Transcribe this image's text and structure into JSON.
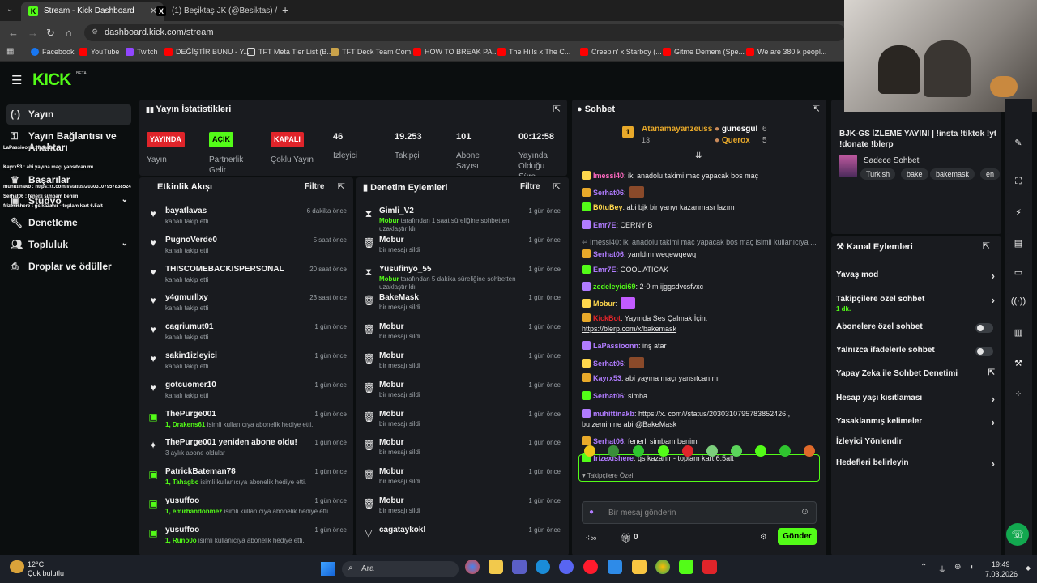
{
  "browser": {
    "tabs": [
      {
        "title": "Stream - Kick Dashboard",
        "fav": "K"
      },
      {
        "title": "(1) Beşiktaş JK (@Besiktas) / X",
        "fav": "X"
      }
    ],
    "url": "dashboard.kick.com/stream",
    "bookmarks": [
      "Facebook",
      "YouTube",
      "Twitch",
      "DEĞİŞTİR BUNU - Y...",
      "TFT Meta Tier List (B...",
      "TFT Deck Team Com...",
      "HOW TO BREAK PA...",
      "The Hills x The C...",
      "Creepin' x Starboy (...",
      "Gitme Demem (Spe...",
      "We are 380 k peopl..."
    ],
    "colors": {
      "kick": "#53fc18",
      "red": "#e0242a",
      "panel": "#191b1f"
    }
  },
  "kick": {
    "logo": "KICK",
    "logo_sup": "BETA"
  },
  "sidebar": {
    "items": [
      {
        "label": "Yayın",
        "icon": "stream-icon"
      },
      {
        "label": "Yayın Bağlantısı ve Anahtarı",
        "icon": "key-icon"
      },
      {
        "label": "Başarılar",
        "icon": "trophy-icon"
      },
      {
        "label": "Stüdyo",
        "icon": "studio-icon"
      },
      {
        "label": "Denetleme",
        "icon": "wrench-icon"
      },
      {
        "label": "Topluluk",
        "icon": "people-icon"
      },
      {
        "label": "Droplar ve ödüller",
        "icon": "gift-icon"
      }
    ]
  },
  "stats": {
    "title": "Yayın İstatistikleri",
    "items": [
      {
        "value": "YAYINDA",
        "label": "Yayın",
        "kind": "badge-red"
      },
      {
        "value": "AÇIK",
        "label": "Partnerlik Gelir",
        "kind": "badge-green"
      },
      {
        "value": "KAPALI",
        "label": "Çoklu Yayın",
        "kind": "badge-red"
      },
      {
        "value": "46",
        "label": "İzleyici"
      },
      {
        "value": "19.253",
        "label": "Takipçi"
      },
      {
        "value": "101",
        "label": "Abone Sayısı"
      },
      {
        "value": "00:12:58",
        "label": "Yayında Olduğu Süre"
      }
    ]
  },
  "activity": {
    "title": "Etkinlik Akışı",
    "filter": "Filtre",
    "rows": [
      {
        "name": "bayatlavas",
        "desc": "kanalı takip etti",
        "time": "6 dakika önce",
        "icon": "heart-icon"
      },
      {
        "name": "PugnoVerde0",
        "desc": "kanalı takip etti",
        "time": "5 saat önce",
        "icon": "heart-icon"
      },
      {
        "name": "THISCOMEBACKISPERSONAL",
        "desc": "kanalı takip etti",
        "time": "20 saat önce",
        "icon": "heart-icon"
      },
      {
        "name": "y4gmurllxy",
        "desc": "kanalı takip etti",
        "time": "23 saat önce",
        "icon": "heart-icon"
      },
      {
        "name": "cagriumut01",
        "desc": "kanalı takip etti",
        "time": "1 gün önce",
        "icon": "heart-icon"
      },
      {
        "name": "sakin1izleyici",
        "desc": "kanalı takip etti",
        "time": "1 gün önce",
        "icon": "heart-icon"
      },
      {
        "name": "gotcuomer10",
        "desc": "kanalı takip etti",
        "time": "1 gün önce",
        "icon": "heart-icon"
      },
      {
        "name": "ThePurge001",
        "hl": "1, Drakens61",
        "desc": " isimli kullanıcıya abonelik hediye etti.",
        "time": "1 gün önce",
        "icon": "gift-icon"
      },
      {
        "name": "ThePurge001 yeniden abone oldu!",
        "desc": "3 aylık abone oldular",
        "time": "1 gün önce",
        "icon": "sparkle-icon"
      },
      {
        "name": "PatrickBateman78",
        "hl": "1, Tahagbc",
        "desc": " isimli kullanıcıya abonelik hediye etti.",
        "time": "1 gün önce",
        "icon": "gift-icon"
      },
      {
        "name": "yusuffoo",
        "hl": "1, emirhandonmez",
        "desc": " isimli kullanıcıya abonelik hediye etti.",
        "time": "1 gün önce",
        "icon": "gift-icon"
      },
      {
        "name": "yusuffoo",
        "hl": "1, Runo0o",
        "desc": " isimli kullanıcıya abonelik hediye etti.",
        "time": "1 gün önce",
        "icon": "gift-icon"
      }
    ]
  },
  "moderation": {
    "title": "Denetim Eylemleri",
    "filter": "Filtre",
    "rows": [
      {
        "name": "Gimli_V2",
        "hl": "Mobur",
        "desc": " tarafından 1 saat süreliğine sohbetten uzaklaştırıldı",
        "time": "1 gün önce",
        "icon": "hourglass-icon"
      },
      {
        "name": "Mobur",
        "desc": "bir mesajı sildi",
        "time": "1 gün önce",
        "icon": "trash-icon"
      },
      {
        "name": "Yusufinyo_55",
        "hl": "Mobur",
        "desc": " tarafından 5 dakika süreliğine sohbetten uzaklaştırıldı",
        "time": "1 gün önce",
        "icon": "hourglass-icon"
      },
      {
        "name": "BakeMask",
        "desc": "bir mesajı sildi",
        "time": "1 gün önce",
        "icon": "trash-icon"
      },
      {
        "name": "Mobur",
        "desc": "bir mesajı sildi",
        "time": "1 gün önce",
        "icon": "trash-icon"
      },
      {
        "name": "Mobur",
        "desc": "bir mesajı sildi",
        "time": "1 gün önce",
        "icon": "trash-icon"
      },
      {
        "name": "Mobur",
        "desc": "bir mesajı sildi",
        "time": "1 gün önce",
        "icon": "trash-icon"
      },
      {
        "name": "Mobur",
        "desc": "bir mesajı sildi",
        "time": "1 gün önce",
        "icon": "trash-icon"
      },
      {
        "name": "Mobur",
        "desc": "bir mesajı sildi",
        "time": "1 gün önce",
        "icon": "trash-icon"
      },
      {
        "name": "Mobur",
        "desc": "bir mesajı sildi",
        "time": "1 gün önce",
        "icon": "trash-icon"
      },
      {
        "name": "Mobur",
        "desc": "bir mesajı sildi",
        "time": "1 gün önce",
        "icon": "trash-icon"
      },
      {
        "name": "cagataykokl",
        "desc": "",
        "time": "1 gün önce",
        "icon": "filter-icon"
      }
    ]
  },
  "chat": {
    "title": "Sohbet",
    "top_user": "Atanamayanzeuss",
    "top_count": "13",
    "pill1_user": "gunesgul",
    "pill1_count": "6",
    "pill2_user": "Querox",
    "pill2_count": "5",
    "messages": [
      {
        "user": "Imessi40",
        "color": "#ff6ac1",
        "text": ": iki anadolu takimi mac yapacak bos maç"
      },
      {
        "user": "Serhat06",
        "color": "#b17cff",
        "text": ":"
      },
      {
        "user": "B0tuBey",
        "color": "#ffd84d",
        "text": ": abi bjk bir yarıyı kazanması lazım"
      },
      {
        "user": "Emr7E",
        "color": "#b17cff",
        "text": ": CERNY B"
      },
      {
        "user": "",
        "color": "#9aa0a5",
        "text": "↩ Imessi40: iki anadolu takimi mac yapacak bos maç isimli kullanıcıya ..."
      },
      {
        "user": "Serhat06",
        "color": "#b17cff",
        "text": ": yarıldım weqewqewq"
      },
      {
        "user": "Emr7E",
        "color": "#b17cff",
        "text": ": GOOL ATICAK"
      },
      {
        "user": "zedeleyici69",
        "color": "#53fc18",
        "text": ": 2-0 m ijggsdvcsfvxc"
      },
      {
        "user": "Mobur",
        "color": "#ffd84d",
        "text": ":"
      },
      {
        "user": "KickBot",
        "color": "#e0242a",
        "text": ": Yayında Ses Çalmak İçin:"
      },
      {
        "user": "",
        "color": "#e8e8e8",
        "text": "https://blerp.com/x/bakemask"
      },
      {
        "user": "LaPassioonn",
        "color": "#b17cff",
        "text": ": inş atar"
      },
      {
        "user": "Serhat06",
        "color": "#b17cff",
        "text": ":"
      },
      {
        "user": "Kayrx53",
        "color": "#b17cff",
        "text": ": abi yayına maçı yansıtcan mı"
      },
      {
        "user": "Serhat06",
        "color": "#b17cff",
        "text": ": simba"
      },
      {
        "user": "muhittinakb",
        "color": "#b17cff",
        "text": ": https://x. com/i/status/2030310795783852426 ,"
      },
      {
        "user": "",
        "color": "#e8e8e8",
        "text": "bu zemin ne abi @BakeMask"
      },
      {
        "user": "Serhat06",
        "color": "#b17cff",
        "text": ": fenerli simbam benim"
      },
      {
        "user": "frizexishere",
        "color": "#b17cff",
        "text": ": gs kazanır - toplam kart 6.5alt"
      }
    ],
    "followers_only": "Takipçilere Özel",
    "input_placeholder": "Bir mesaj gönderin",
    "points": "0",
    "send": "Gönder"
  },
  "stream_info": {
    "title": "BJK-GS İZLEME YAYINI | !insta !tiktok !yt !donate !blerp",
    "category": "Sadece Sohbet",
    "tags": [
      "Turkish",
      "bake",
      "bakemask",
      "en"
    ]
  },
  "channel_actions": {
    "title": "Kanal Eylemleri",
    "items": [
      {
        "label": "Yavaş mod",
        "control": "arrow"
      },
      {
        "label": "Takipçilere özel sohbet",
        "sub": "1 dk.",
        "control": "arrow"
      },
      {
        "label": "Abonelere özel sohbet",
        "control": "toggle"
      },
      {
        "label": "Yalnızca ifadelerle sohbet",
        "control": "toggle"
      },
      {
        "label": "Yapay Zeka ile Sohbet Denetimi",
        "control": "ext"
      },
      {
        "label": "Hesap yaşı kısıtlaması",
        "control": "arrow"
      },
      {
        "label": "Yasaklanmış kelimeler",
        "control": "arrow"
      },
      {
        "label": "İzleyici Yönlendir",
        "control": "none"
      },
      {
        "label": "Hedefleri belirleyin",
        "control": "arrow"
      }
    ]
  },
  "overlay": {
    "lines": [
      "LaPassioonn : inş atar",
      "Kayrx53 : abi yayına maçı yansıtcan mı",
      "muhittinakb : https://x.com/i/status/2030310795783852426 ,",
      "Serhat06 : fenerli simbam benim",
      "frizexishere : gs kazanır - toplam kart 6.5alt"
    ]
  },
  "taskbar": {
    "weather_temp": "12°C",
    "weather_desc": "Çok bulutlu",
    "search": "Ara",
    "time": "19:49",
    "date": "7.03.2026"
  }
}
